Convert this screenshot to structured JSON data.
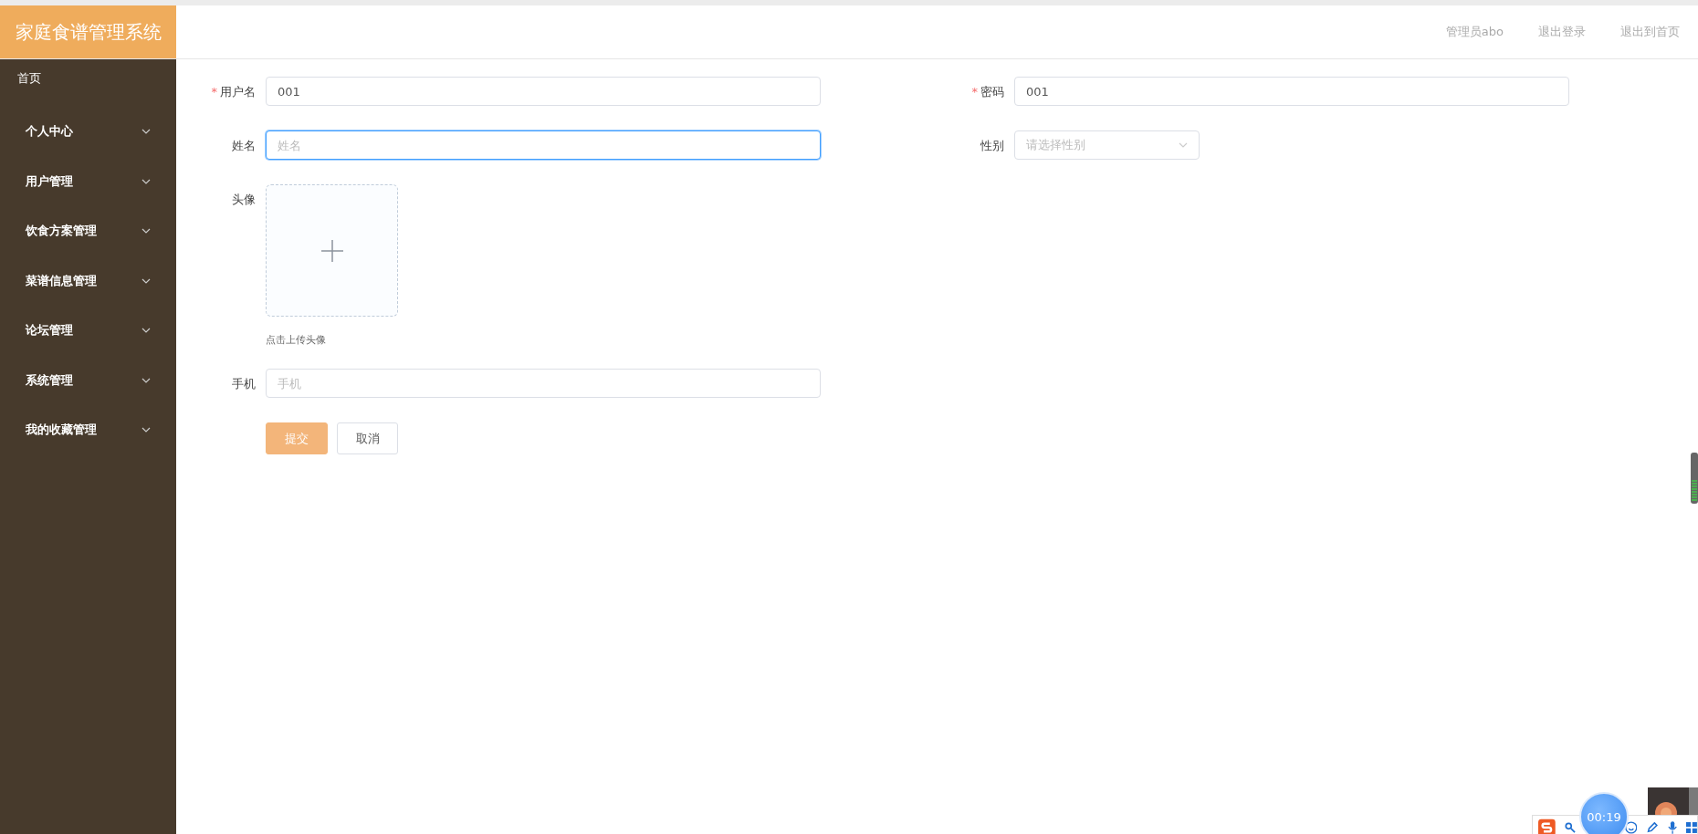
{
  "app_title": "家庭食谱管理系统",
  "header_actions": [
    "管理员abo",
    "退出登录",
    "退出到首页"
  ],
  "sidebar": {
    "home": "首页",
    "items": [
      {
        "label": "个人中心",
        "expanded": false
      },
      {
        "label": "用户管理",
        "expanded": false
      },
      {
        "label": "饮食方案管理",
        "expanded": false
      },
      {
        "label": "菜谱信息管理",
        "expanded": false
      },
      {
        "label": "论坛管理",
        "expanded": false
      },
      {
        "label": "系统管理",
        "expanded": false
      },
      {
        "label": "我的收藏管理",
        "expanded": false
      }
    ]
  },
  "form": {
    "left": [
      {
        "kind": "text",
        "label": "用户名",
        "required_mark": "*",
        "value": "001",
        "focused": false
      },
      {
        "kind": "text",
        "label": "姓名",
        "placeholder": "姓名",
        "focused": true
      },
      {
        "kind": "upload",
        "label": "头像",
        "hint": "点击上传头像"
      },
      {
        "kind": "text",
        "label": "手机",
        "placeholder": "手机",
        "focused": false
      }
    ],
    "right": [
      {
        "kind": "text",
        "label": "密码",
        "required_mark": "*",
        "value": "001",
        "focused": false
      },
      {
        "kind": "select",
        "label": "性别",
        "placeholder": "请选择性别"
      }
    ],
    "buttons": [
      {
        "label": "提交",
        "primary": true
      },
      {
        "label": "取消",
        "primary": false
      }
    ]
  },
  "overlay": {
    "timer": "00:19"
  }
}
